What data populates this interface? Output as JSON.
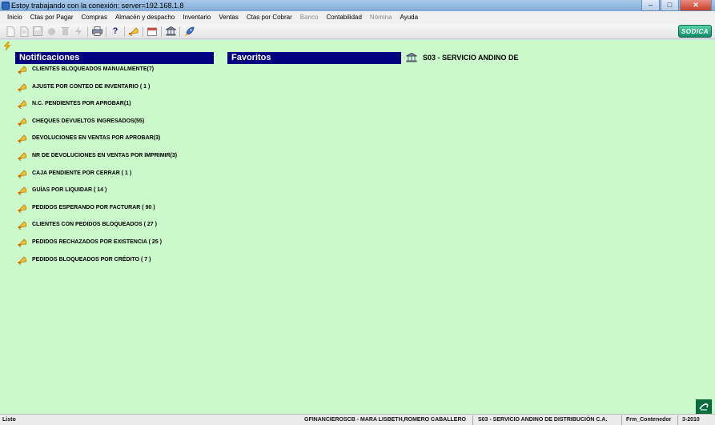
{
  "window": {
    "title": "Estoy trabajando con la conexión: server=192.168.1.8",
    "minimize": "–",
    "maximize": "□",
    "close": "✕"
  },
  "menu": [
    {
      "label": "Inicio",
      "enabled": true
    },
    {
      "label": "Ctas por Pagar",
      "enabled": true
    },
    {
      "label": "Compras",
      "enabled": true
    },
    {
      "label": "Almacén y despacho",
      "enabled": true
    },
    {
      "label": "Inventario",
      "enabled": true
    },
    {
      "label": "Ventas",
      "enabled": true
    },
    {
      "label": "Ctas por Cobrar",
      "enabled": true
    },
    {
      "label": "Banco",
      "enabled": false
    },
    {
      "label": "Contabilidad",
      "enabled": true
    },
    {
      "label": "Nómina",
      "enabled": false
    },
    {
      "label": "Ayuda",
      "enabled": true
    }
  ],
  "toolbar": {
    "icons": [
      "new-document-icon",
      "document-icon",
      "save-icon",
      "record-icon",
      "delete-icon",
      "refresh-icon",
      "print-icon",
      "help-icon",
      "notifications-bell-icon",
      "calendar-icon",
      "bank-icon",
      "rocket-icon"
    ],
    "help_glyph": "?",
    "logo_text": "SODICA"
  },
  "notifications": {
    "title": "Notificaciones",
    "items": [
      "CLIENTES BLOQUEADOS MANUALMENTE(7)",
      "AJUSTE POR CONTEO DE INVENTARIO ( 1 )",
      "N.C. PENDIENTES POR APROBAR(1)",
      "CHEQUES DEVUELTOS INGRESADOS(55)",
      "DEVOLUCIONES EN VENTAS POR APROBAR(3)",
      "NR DE DEVOLUCIONES EN VENTAS POR IMPRIMIR(3)",
      "CAJA PENDIENTE POR CERRAR ( 1 )",
      "GUÍAS POR LIQUIDAR ( 14 )",
      "PEDIDOS ESPERANDO POR FACTURAR ( 90 )",
      "CLIENTES CON PEDIDOS BLOQUEADOS ( 27 )",
      "PEDIDOS RECHAZADOS POR EXISTENCIA ( 25 )",
      "PEDIDOS BLOQUEADOS POR CRÉDITO ( 7 )"
    ]
  },
  "favorites": {
    "title": "Favoritos"
  },
  "company": {
    "name": "S03 - SERVICIO ANDINO DE"
  },
  "status": {
    "state": "Listo",
    "user": "GFINANCIEROSCB - MARA LISBETH,ROMERO CABALLERO",
    "company": "S03 - SERVICIO ANDINO DE DISTRIBUCIÓN C.A.",
    "form": "Frm_Contenedor",
    "period": "3-2010"
  },
  "colors": {
    "main_background": "#ccf9cc",
    "panel_header": "#000080"
  }
}
